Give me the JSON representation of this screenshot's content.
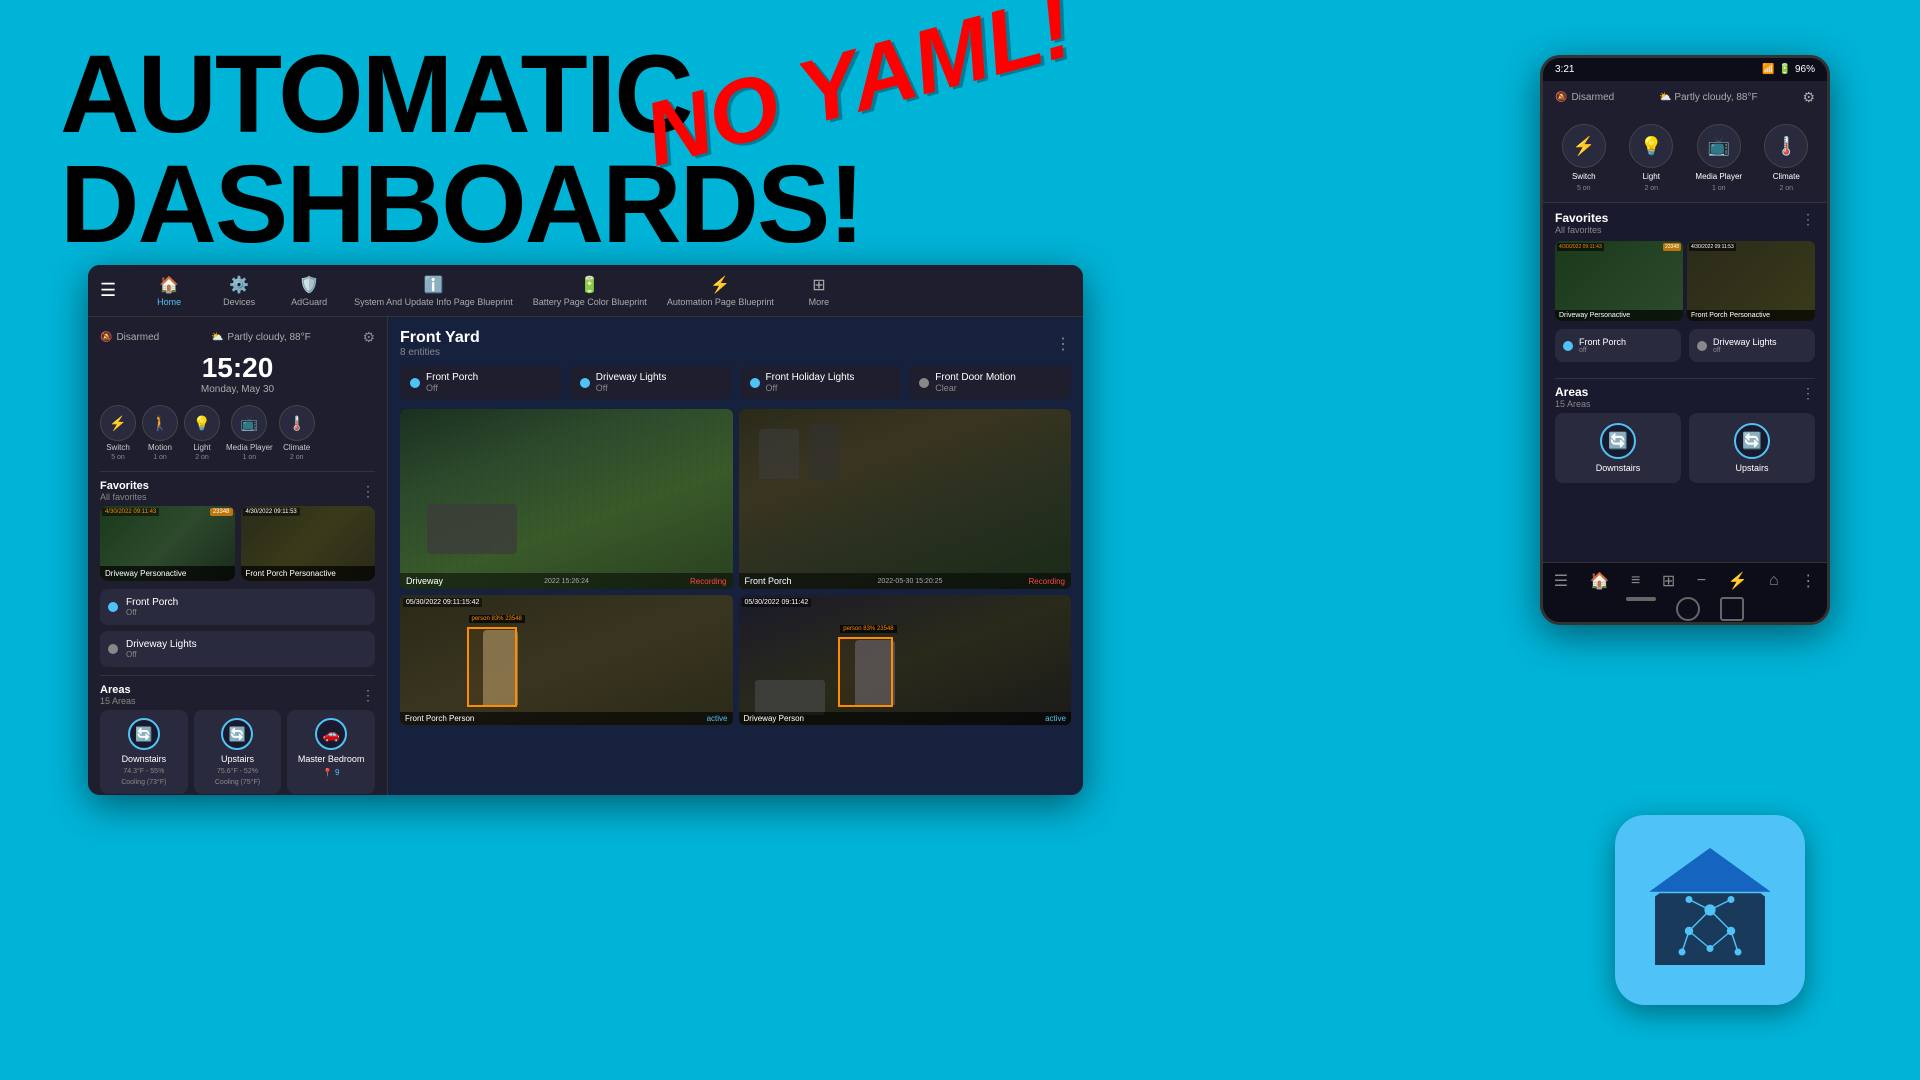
{
  "background_color": "#00b4d8",
  "title": {
    "line1": "AUTOMATIC",
    "line2": "DASHBOARDS!",
    "accent": "NO YAML!"
  },
  "dashboard": {
    "nav_items": [
      {
        "label": "Home",
        "icon": "🏠",
        "active": true
      },
      {
        "label": "Devices",
        "icon": "⚙️",
        "active": false
      },
      {
        "label": "AdGuard",
        "icon": "🛡️",
        "active": false
      },
      {
        "label": "System And Update Info Page Blueprint",
        "icon": "ℹ️",
        "active": false
      },
      {
        "label": "Battery Page Color Blueprint",
        "icon": "🔋",
        "active": false
      },
      {
        "label": "Automation Page Blueprint",
        "icon": "⚡",
        "active": false
      },
      {
        "label": "More",
        "icon": "⋮⋮",
        "active": false
      }
    ],
    "sidebar": {
      "disarmed": "Disarmed",
      "weather": "Partly cloudy, 88°F",
      "time": "15:20",
      "date": "Monday, May 30",
      "entities": [
        {
          "name": "Switch",
          "count": "5 on",
          "icon": "⚡"
        },
        {
          "name": "Motion",
          "count": "1 on",
          "icon": "🚶"
        },
        {
          "name": "Light",
          "count": "2 on",
          "icon": "💡"
        },
        {
          "name": "Media Player",
          "count": "1 on",
          "icon": "📺"
        },
        {
          "name": "Climate",
          "count": "2 on",
          "icon": "🌡️"
        }
      ],
      "favorites_title": "Favorites",
      "favorites_sub": "All favorites",
      "favorites": [
        {
          "name": "Driveway Personac...",
          "type": "camera"
        },
        {
          "name": "Front Porch Person...",
          "type": "camera"
        },
        {
          "name": "Front Porch",
          "status": "Off",
          "type": "light"
        },
        {
          "name": "Driveway Lights",
          "status": "Off",
          "type": "light"
        }
      ],
      "areas_title": "Areas",
      "areas_sub": "15 Areas",
      "areas": [
        {
          "name": "Downstairs",
          "temp": "74.3°F - 55%",
          "cooling": "Cooling (73°F)",
          "icon": "🔄"
        },
        {
          "name": "Upstairs",
          "temp": "75.6°F - 52%",
          "cooling": "Cooling (75°F)",
          "icon": "🔄"
        },
        {
          "name": "Master Bedroom",
          "icon": "🚗"
        }
      ]
    },
    "main": {
      "title": "Front Yard",
      "subtitle": "8 entities",
      "entity_status": [
        {
          "name": "Front Porch",
          "status": "Off",
          "dot": "blue"
        },
        {
          "name": "Driveway Lights",
          "status": "Off",
          "dot": "blue"
        },
        {
          "name": "Front Holiday Lights",
          "status": "Off",
          "dot": "blue"
        },
        {
          "name": "Front Door Motion",
          "status": "Clear",
          "dot": "gray"
        }
      ],
      "cameras": [
        {
          "name": "Driveway",
          "timestamp": "2022 15:26:24",
          "recording": "Recording",
          "type": "driveway"
        },
        {
          "name": "Front Porch",
          "timestamp": "2022-05-30 15:20:25",
          "recording": "Recording",
          "type": "porch"
        }
      ],
      "detections": [
        {
          "name": "Front Porch Person",
          "status": "active",
          "timestamp": "05/30/2022 09:11:15:42",
          "badge": "person 83%  23548"
        },
        {
          "name": "Driveway Person",
          "status": "active",
          "timestamp": "05/30/2022 09:11:42",
          "badge": "person 83%  23548"
        }
      ]
    }
  },
  "phone": {
    "time": "3:21",
    "battery": "96%",
    "disarmed": "Disarmed",
    "weather": "Partly cloudy, 88°F",
    "entities": [
      {
        "name": "Switch",
        "count": "5 on",
        "icon": "⚡"
      },
      {
        "name": "Light",
        "count": "2 on",
        "icon": "💡"
      },
      {
        "name": "Media Player",
        "count": "1 on",
        "icon": "📺"
      },
      {
        "name": "Climate",
        "count": "2 on",
        "icon": "🌡️"
      }
    ],
    "favorites_title": "Favorites",
    "favorites_sub": "All favorites",
    "cameras": [
      {
        "name": "Driveway Personactive"
      },
      {
        "name": "Front Porch Personactive"
      }
    ],
    "lights": [
      {
        "name": "Front Porch",
        "status": "off"
      },
      {
        "name": "Driveway Lights",
        "status": "off"
      }
    ],
    "areas_title": "Areas",
    "areas_sub": "15 Areas",
    "areas": [
      {
        "name": "Downstairs"
      },
      {
        "name": "Upstairs"
      }
    ],
    "nav_icons": [
      "☰",
      "🏠",
      "≡",
      "⊞",
      "−",
      "⚡",
      "⌂",
      "⋮⋮"
    ]
  },
  "sidebar_items_phone": {
    "switch_label": "Switch 5 on",
    "light_label": "Light 2 on",
    "media_player_label": "Media Player 1 on"
  }
}
